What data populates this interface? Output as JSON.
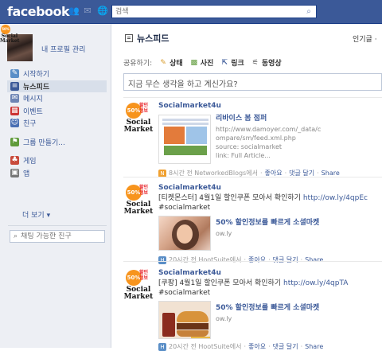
{
  "topbar": {
    "logo": "facebook",
    "search_placeholder": "검색"
  },
  "profile": {
    "link": "내 프로필 관리"
  },
  "nav": [
    {
      "label": "시작하기",
      "icon": "edit-icon",
      "color": "#5b8fc7"
    },
    {
      "label": "뉴스피드",
      "icon": "news-feed-icon",
      "color": "#3b5998",
      "active": true
    },
    {
      "label": "메시지",
      "icon": "messages-icon",
      "color": "#6d84b4"
    },
    {
      "label": "이벤트",
      "icon": "calendar-icon",
      "color": "#c33"
    },
    {
      "label": "친구",
      "icon": "friends-icon",
      "color": "#4a6fb3"
    },
    {
      "label": "그룹 만들기...",
      "icon": "groups-icon",
      "color": "#5f9b3a"
    },
    {
      "label": "게임",
      "icon": "games-icon",
      "color": "#c84a3b"
    },
    {
      "label": "앱",
      "icon": "apps-icon",
      "color": "#777"
    }
  ],
  "more_label": "더 보기",
  "chat": {
    "search_placeholder": "채팅 가능한 친구"
  },
  "main": {
    "title": "뉴스피드",
    "sort_label": "인기글 ·",
    "share_label": "공유하기:",
    "share_options": [
      {
        "label": "상태",
        "icon": "status-icon"
      },
      {
        "label": "사진",
        "icon": "photo-icon"
      },
      {
        "label": "링크",
        "icon": "link-icon"
      },
      {
        "label": "동영상",
        "icon": "video-icon"
      }
    ],
    "status_placeholder": "지금 무슨 생각을 하고 계신가요?"
  },
  "avatar_badge": {
    "circle": "50%",
    "tag_line1": "할인",
    "tag_line2": "정보",
    "text_line1": "Social",
    "text_line2": "Market"
  },
  "stories": [
    {
      "actor": "Socialmarket4u",
      "message": "",
      "message_link": "",
      "link_title": "리바이스 봄 점퍼",
      "link_lines": [
        "http://www.damoyer.com/_data/c",
        "ompare/sm/feed.xml.php",
        "source: socialmarket",
        "link: Full Article..."
      ],
      "footer_time": "8시간 전 NetworkedBlogs에서",
      "footer_actions": [
        "좋아요",
        "댓글 달기",
        "Share"
      ]
    },
    {
      "actor": "Socialmarket4u",
      "message": "[티켓몬스터] 4월1일 할인쿠폰 모아서 확인하기",
      "message_link": "http://ow.ly/4qpEc",
      "message_tag": "#socialmarket",
      "link_title": "50% 할인정보를 빠르게 소셜마켓",
      "link_lines": [
        "ow.ly"
      ],
      "footer_time": "20시간 전 HootSuite에서",
      "footer_actions": [
        "좋아요",
        "댓글 달기",
        "Share"
      ]
    },
    {
      "actor": "Socialmarket4u",
      "message": "[쿠팡] 4월1일 할인쿠폰 모아서 확인하기",
      "message_link": "http://ow.ly/4qpTA",
      "message_tag": "#socialmarket",
      "link_title": "50% 할인정보를 빠르게 소셜마켓",
      "link_lines": [
        "ow.ly"
      ],
      "footer_time": "20시간 전 HootSuite에서",
      "footer_actions": [
        "좋아요",
        "댓글 달기",
        "Share"
      ]
    }
  ],
  "colors": {
    "brand": "#3b5998",
    "link": "#3b5998",
    "sidebar_bg": "#edeff4"
  }
}
